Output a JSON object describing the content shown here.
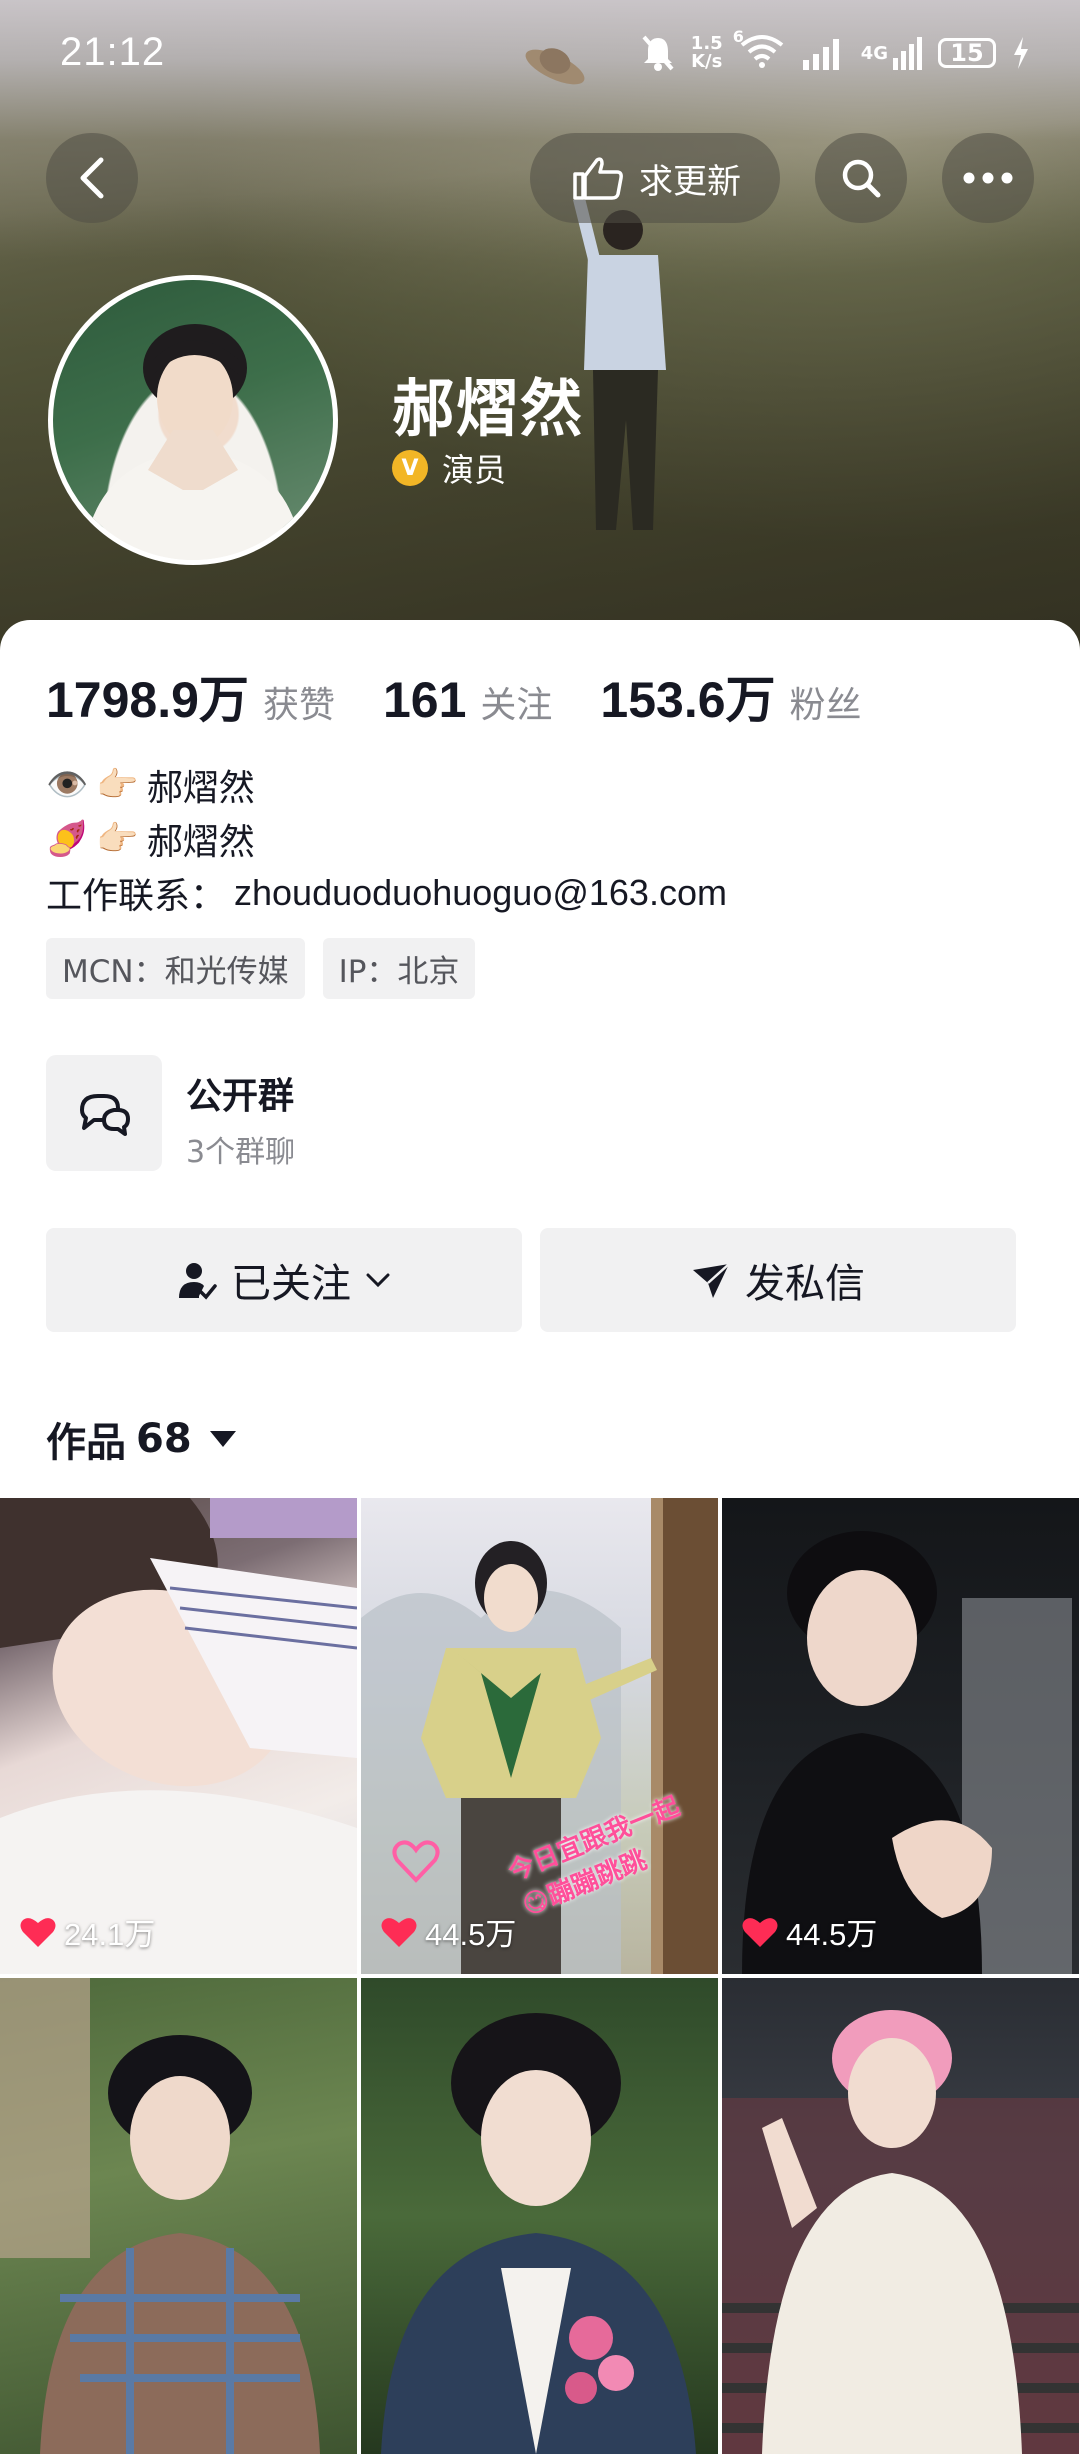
{
  "status_bar": {
    "time": "21:12",
    "net_speed_value": "1.5",
    "net_speed_unit": "K/s",
    "wifi_badge": "6",
    "cell_label": "4G",
    "battery": "15"
  },
  "header": {
    "update_label": "求更新"
  },
  "profile": {
    "name": "郝熠然",
    "verify_badge": "V",
    "verify_label": "演员"
  },
  "stats": [
    {
      "value": "1798.9万",
      "label": "获赞"
    },
    {
      "value": "161",
      "label": "关注"
    },
    {
      "value": "153.6万",
      "label": "粉丝"
    }
  ],
  "bio": {
    "lines": [
      {
        "emoji": "👁️",
        "emoji2": "👉🏻",
        "text": "郝熠然"
      },
      {
        "emoji": "🍠",
        "emoji2": "👉🏻",
        "text": "郝熠然"
      }
    ],
    "contact_label": "工作联系：",
    "contact_value": "zhouduoduohuoguo@163.com"
  },
  "tags": [
    "MCN：和光传媒",
    "IP：北京"
  ],
  "group": {
    "title": "公开群",
    "subtitle": "3个群聊"
  },
  "actions": {
    "follow_label": "已关注",
    "message_label": "发私信"
  },
  "works": {
    "label": "作品",
    "count": "68"
  },
  "tiles": [
    {
      "likes": "24.1万"
    },
    {
      "likes": "44.5万",
      "overlay_text": "今日宜跟我一起😋蹦蹦跳跳"
    },
    {
      "likes": "44.5万"
    },
    {
      "likes": ""
    },
    {
      "likes": ""
    },
    {
      "likes": ""
    }
  ],
  "colors": {
    "accent_heart": "#fe2c55",
    "verify_gold": "#f2b626",
    "button_bg": "#f1f1f2",
    "muted_text": "#8a8b91"
  }
}
